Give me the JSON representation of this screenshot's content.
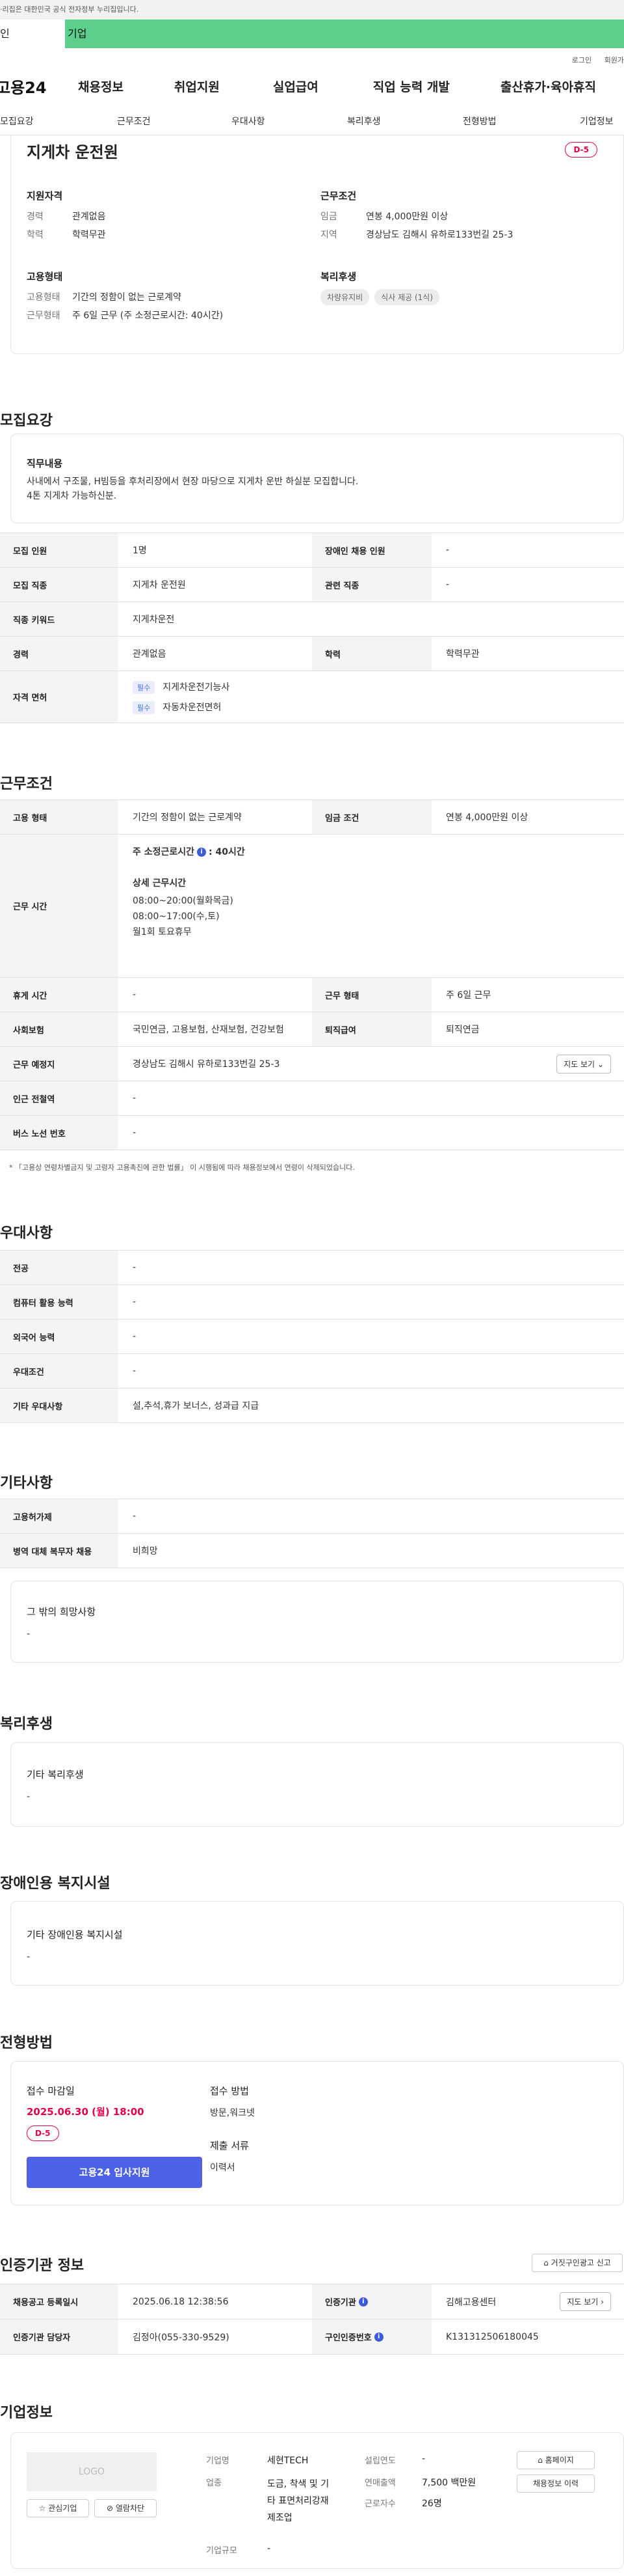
{
  "gov_notice": "·리집은 대한민국 공식 전자정부 누리집입니다.",
  "tabs": {
    "individual": "인",
    "enterprise": "기업"
  },
  "util": {
    "login": "로그인",
    "join": "회원가"
  },
  "gnb": {
    "logo": "고용24",
    "menus": [
      "채용정보",
      "취업지원",
      "실업급여",
      "직업 능력 개발",
      "출산휴가·육아휴직"
    ]
  },
  "subnav": [
    "모집요강",
    "근무조건",
    "우대사항",
    "복리후생",
    "전형방법",
    "기업정보"
  ],
  "summary": {
    "title": "지게차 운전원",
    "dday": "D-5",
    "qual": {
      "heading": "지원자격",
      "career_k": "경력",
      "career_v": "관계없음",
      "edu_k": "학력",
      "edu_v": "학력무관"
    },
    "cond": {
      "heading": "근무조건",
      "wage_k": "임금",
      "wage_v": "연봉 4,000만원 이상",
      "area_k": "지역",
      "area_v": "경상남도 김해시 유하로133번길 25-3"
    },
    "emp": {
      "heading": "고용형태",
      "type_k": "고용형태",
      "type_v": "기간의 정함이 없는 근로계약",
      "work_k": "근무형태",
      "work_v": "주 6일 근무 (주 소정근로시간: 40시간)"
    },
    "welfare": {
      "heading": "복리후생",
      "pills": [
        "차량유지비",
        "식사 제공 (1식)"
      ]
    }
  },
  "recruit": {
    "heading": "모집요강",
    "duty_h": "직무내용",
    "duty_t1": "사내에서 구조물, H빔등을 후처리장에서 현장 마당으로 지게차 운반 하실분 모집합니다.",
    "duty_t2": "4톤 지게차 가능하신분.",
    "headcount_k": "모집 인원",
    "headcount_v": "1명",
    "disabled_k": "장애인 채용 인원",
    "disabled_v": "-",
    "job_k": "모집 직종",
    "job_v": "지게차 운전원",
    "rel_k": "관련 직종",
    "rel_v": "-",
    "kw_k": "직종 키워드",
    "kw_v": "지게차운전",
    "career_k": "경력",
    "career_v": "관계없음",
    "edu_k": "학력",
    "edu_v": "학력무관",
    "license_k": "자격 면허",
    "req": "필수",
    "license1": "지게차운전기능사",
    "license2": "자동차운전면허"
  },
  "work": {
    "heading": "근무조건",
    "type_k": "고용 형태",
    "type_v": "기간의 정함이 없는 근로계약",
    "wage_k": "임금 조건",
    "wage_v": "연봉 4,000만원 이상",
    "time_k": "근무 시간",
    "hours_label": "주 소정근로시간",
    "hours_value": ": 40시간",
    "detail_h": "상세 근무시간",
    "detail1": "08:00~20:00(월화목금)",
    "detail2": "08:00~17:00(수,토)",
    "detail3": "월1회 토요휴무",
    "rest_k": "휴게 시간",
    "rest_v": "-",
    "worktype_k": "근무 형태",
    "worktype_v": "주 6일 근무",
    "ins_k": "사회보험",
    "ins_v": "국민연금, 고용보험, 산재보험, 건강보험",
    "ret_k": "퇴직급여",
    "ret_v": "퇴직연금",
    "loc_k": "근무 예정지",
    "loc_v": "경상남도 김해시 유하로133번길 25-3",
    "map_btn": "지도 보기",
    "sub_k": "인근 전철역",
    "sub_v": "-",
    "bus_k": "버스 노선 번호",
    "bus_v": "-",
    "note": "* 「고용상 연령차별금지 및 고령자 고용촉진에 관한 법률」 이 시행됨에 따라 채용정보에서 연령이 삭제되었습니다."
  },
  "pref": {
    "heading": "우대사항",
    "major_k": "전공",
    "major_v": "-",
    "pc_k": "컴퓨터 활용 능력",
    "pc_v": "-",
    "lang_k": "외국어 능력",
    "lang_v": "-",
    "cond_k": "우대조건",
    "cond_v": "-",
    "etc_k": "기타 우대사항",
    "etc_v": "설,추석,휴가 보너스, 성과급 지급"
  },
  "other": {
    "heading": "기타사항",
    "emp_k": "고용허가제",
    "emp_v": "-",
    "mil_k": "병역 대체 복무자 채용",
    "mil_v": "비희망",
    "wish_h": "그 밖의 희망사항",
    "wish_v": "-"
  },
  "benefit": {
    "heading": "복리후생",
    "box_h": "기타 복리후생",
    "box_v": "-"
  },
  "facility": {
    "heading": "장애인용 복지시설",
    "box_h": "기타 장애인용 복지시설",
    "box_v": "-"
  },
  "apply": {
    "heading": "전형방법",
    "deadline_h": "접수 마감일",
    "deadline_v": "2025.06.30 (월) 18:00",
    "dday": "D-5",
    "btn": "고용24 입사지원",
    "method_h": "접수 방법",
    "method_v": "방문,워크넷",
    "docs_h": "제출 서류",
    "docs_v": "이력서"
  },
  "cert": {
    "heading": "인증기관 정보",
    "report_btn": "거짓구인광고 신고",
    "reg_k": "채용공고 등록일시",
    "reg_v": "2025.06.18 12:38:56",
    "org_k": "인증기관",
    "org_v": "김해고용센터",
    "map_btn": "지도 보기",
    "mgr_k": "인증기관 담당자",
    "mgr_v": "김정아(055-330-9529)",
    "num_k": "구인인증번호",
    "num_v": "K131312506180045"
  },
  "company": {
    "heading": "기업정보",
    "logo": "LOGO",
    "fav_btn": "관심기업",
    "block_btn": "열람차단",
    "name_k": "기업명",
    "name_v": "세현TECH",
    "year_k": "설립연도",
    "year_v": "-",
    "ind_k": "업종",
    "ind_v1": "도금, 착색 및 기",
    "ind_v2": "타 표면처리강재",
    "ind_v3": "제조업",
    "sales_k": "연매출액",
    "sales_v": "7,500 백만원",
    "emp_k": "근로자수",
    "emp_v": "26명",
    "scale_k": "기업규모",
    "scale_v": "-",
    "home_btn": "홈페이지",
    "hist_btn": "채용정보 이력"
  }
}
